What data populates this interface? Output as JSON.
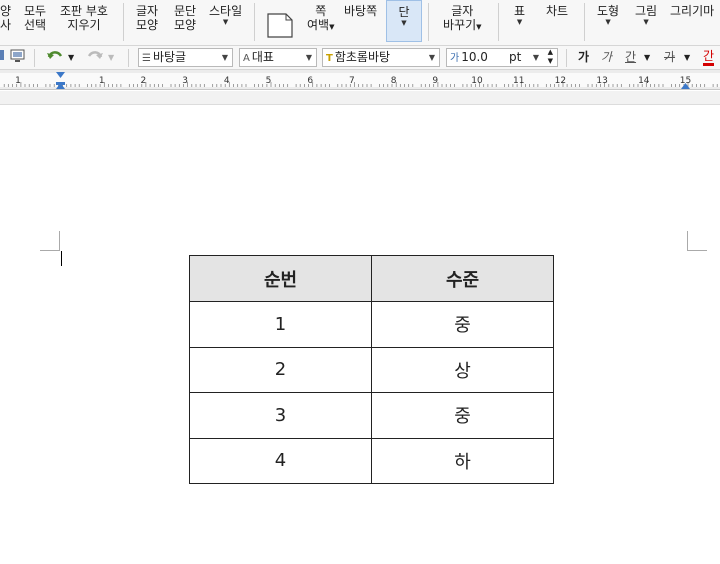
{
  "ribbon": {
    "items": [
      {
        "id": "style-copy",
        "line1": "양",
        "line2": "사"
      },
      {
        "id": "select-all",
        "line1": "모두",
        "line2": "선택"
      },
      {
        "id": "clear-marks",
        "line1": "조판 부호",
        "line2": "지우기"
      },
      {
        "id": "char-shape",
        "line1": "글자",
        "line2": "모양"
      },
      {
        "id": "para-shape",
        "line1": "문단",
        "line2": "모양"
      },
      {
        "id": "style",
        "line1": "스타일",
        "line2": ""
      },
      {
        "id": "page-margin",
        "line1": "쪽",
        "line2": "여백"
      },
      {
        "id": "background-page",
        "line1": "바탕쪽",
        "line2": ""
      },
      {
        "id": "column",
        "line1": "단",
        "line2": ""
      },
      {
        "id": "char-change",
        "line1": "글자",
        "line2": "바꾸기"
      },
      {
        "id": "table",
        "line1": "표",
        "line2": ""
      },
      {
        "id": "chart",
        "line1": "차트",
        "line2": ""
      },
      {
        "id": "shape",
        "line1": "도형",
        "line2": ""
      },
      {
        "id": "picture",
        "line1": "그림",
        "line2": ""
      },
      {
        "id": "drawing",
        "line1": "그리기마",
        "line2": ""
      }
    ]
  },
  "format_bar": {
    "style_name": "바탕글",
    "language": "대표",
    "font_name": "함초롬바탕",
    "font_size": "10.0",
    "font_unit": "pt",
    "bold_label": "가",
    "italic_label": "가",
    "underline_label": "간",
    "strike_label": "가",
    "color_label": "간"
  },
  "ruler": {
    "numbers": [
      "1",
      "1",
      "2",
      "3",
      "4",
      "5",
      "6",
      "7",
      "8",
      "9",
      "10",
      "11",
      "12",
      "13",
      "14",
      "15"
    ]
  },
  "table": {
    "headers": [
      "순번",
      "수준"
    ],
    "rows": [
      [
        "1",
        "중"
      ],
      [
        "2",
        "상"
      ],
      [
        "3",
        "중"
      ],
      [
        "4",
        "하"
      ]
    ]
  },
  "colors": {
    "active_button": "#d9e7f7",
    "header_fill": "#e4e4e4",
    "font_color_accent": "#d40000"
  }
}
